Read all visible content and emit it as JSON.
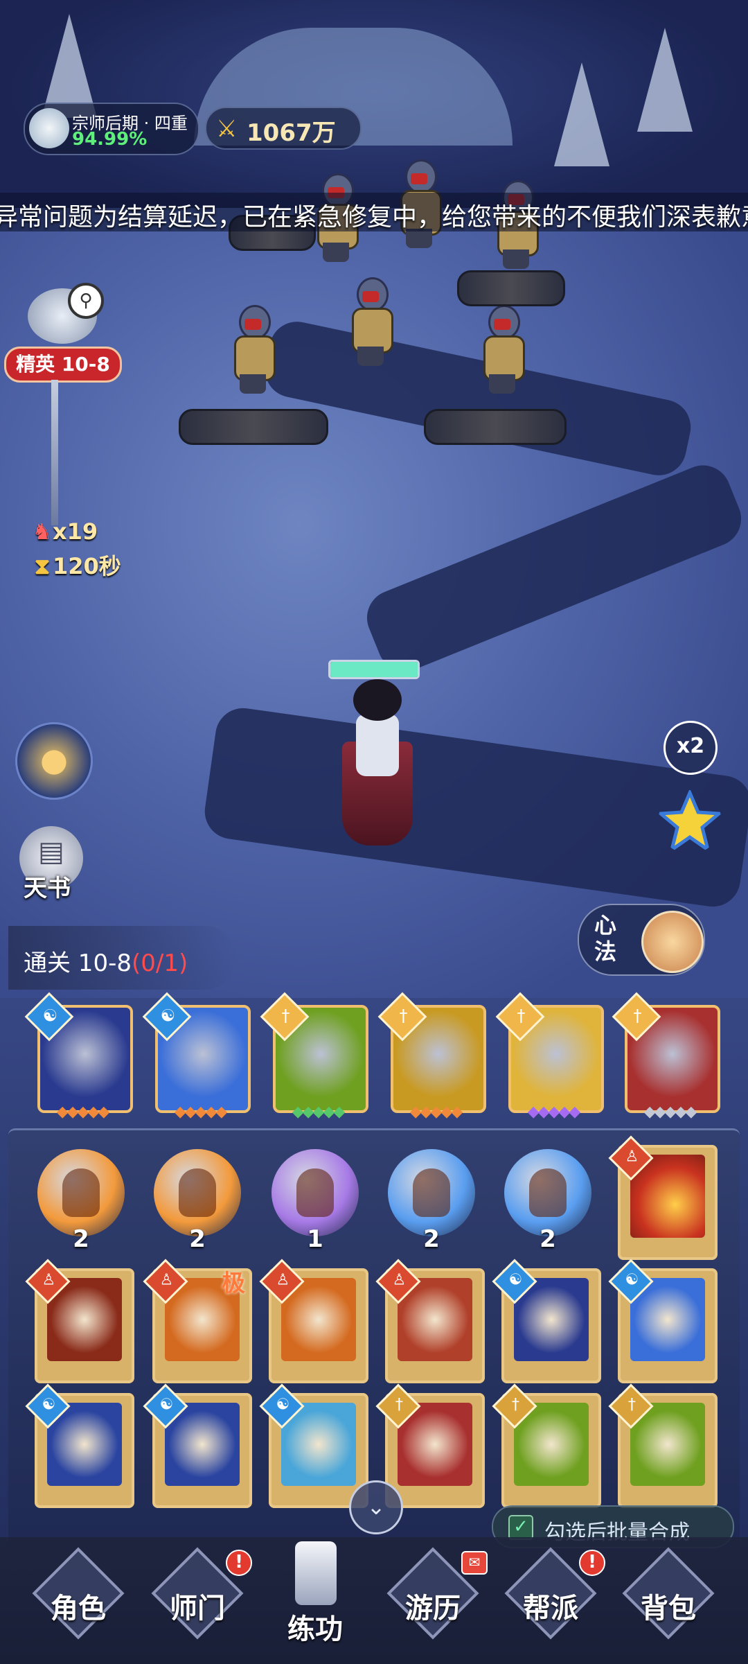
{
  "hud": {
    "realm_title": "宗师后期 · 四重",
    "realm_progress": "94.99%",
    "power_value": "1067万",
    "marquee": "异常问题为结算延迟，已在紧急修复中，给您带来的不便我们深表歉意"
  },
  "stage": {
    "tag": "精英 10-8",
    "enemies_left": "x19",
    "time_left": "120秒",
    "clear_prefix": "通关 10-8",
    "clear_progress": "(0/1)"
  },
  "hero": {
    "hp_fraction": 1.0
  },
  "side": {
    "book_label": "天书",
    "speed_label": "x2",
    "xinfa_label": "心法"
  },
  "skills": [
    {
      "school": "blue",
      "stars": "◆◆◆◆◆",
      "star_color": "#f08a3a",
      "art": "#2a3a8f"
    },
    {
      "school": "blue",
      "stars": "◆◆◆◆◆",
      "star_color": "#f08a3a",
      "art": "#3a6ed8"
    },
    {
      "school": "gold",
      "stars": "◆◆◆◆◆",
      "star_color": "#56c86a",
      "art": "#6fa020"
    },
    {
      "school": "gold",
      "stars": "◆◆◆◆◆",
      "star_color": "#f08a3a",
      "art": "#c99a22"
    },
    {
      "school": "gold",
      "stars": "◆◆◆◆◆",
      "star_color": "#a56bf0",
      "art": "#e0b43a"
    },
    {
      "school": "gold",
      "stars": "◆◆◆◆◆",
      "star_color": "#c4c8d4",
      "art": "#a8302f"
    }
  ],
  "orbs": [
    {
      "count": "2",
      "color": "#f39a3c"
    },
    {
      "count": "2",
      "color": "#f39a3c"
    },
    {
      "count": "1",
      "color": "#a77ae6"
    },
    {
      "count": "2",
      "color": "#5a9ef0"
    },
    {
      "count": "2",
      "color": "#5a9ef0"
    }
  ],
  "batch_label": "勾选后批量合成",
  "extreme_label": "极",
  "nav": [
    {
      "label": "角色"
    },
    {
      "label": "师门"
    },
    {
      "label": "练功"
    },
    {
      "label": "游历"
    },
    {
      "label": "帮派"
    },
    {
      "label": "背包"
    }
  ],
  "icons": {
    "power": "crossed-swords-icon",
    "enemy": "demon-head-icon",
    "timer": "hourglass-icon",
    "zoom": "magnifier-icon"
  },
  "colors": {
    "realm_progress": "#5ef07a",
    "stage_tag": "#c8262b",
    "clear_progress": "#ff4b4b"
  }
}
